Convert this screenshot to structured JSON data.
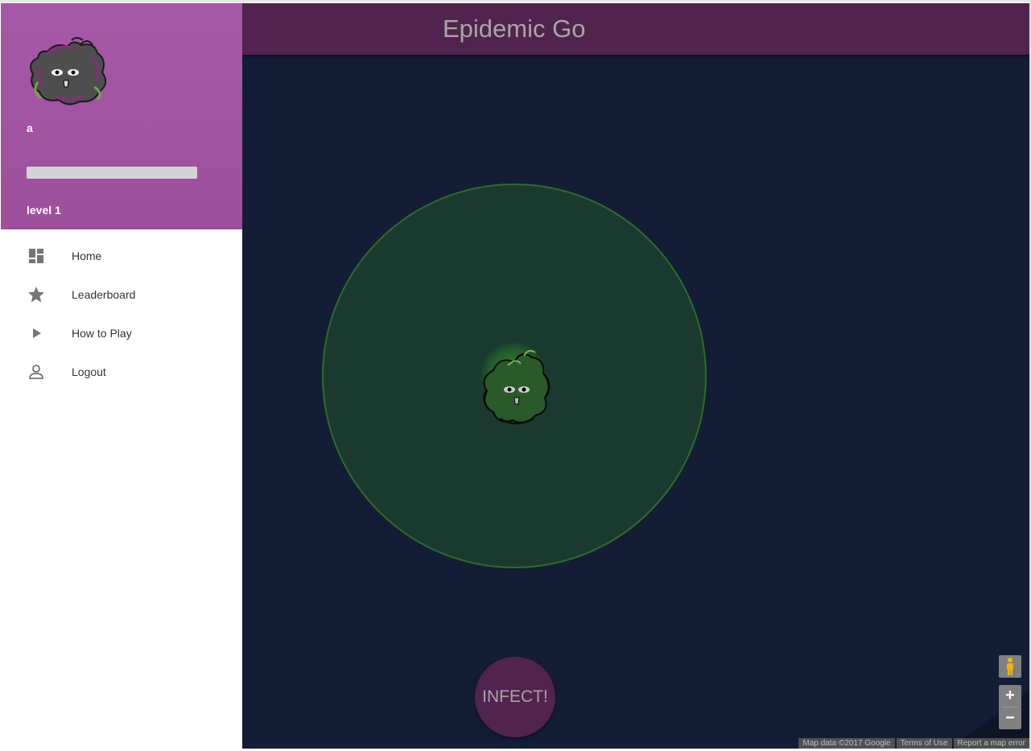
{
  "app": {
    "title": "Epidemic Go"
  },
  "profile": {
    "username": "a",
    "level_label": "level 1",
    "xp_fraction": 0
  },
  "sidebar": {
    "items": [
      {
        "label": "Home",
        "icon": "dashboard-icon"
      },
      {
        "label": "Leaderboard",
        "icon": "star-icon"
      },
      {
        "label": "How to Play",
        "icon": "play-icon"
      },
      {
        "label": "Logout",
        "icon": "person-icon"
      }
    ]
  },
  "map": {
    "infect_label": "INFECT!",
    "zoom_in_label": "+",
    "zoom_out_label": "−",
    "attribution": {
      "data": "Map data ©2017 Google",
      "terms": "Terms of Use",
      "report": "Report a map error"
    }
  },
  "colors": {
    "profile_bg": "#a559a6",
    "header_bg": "#50244f",
    "map_bg": "#131d35",
    "range_fill": "#1b3a2f",
    "range_stroke": "#2a6e2a"
  }
}
